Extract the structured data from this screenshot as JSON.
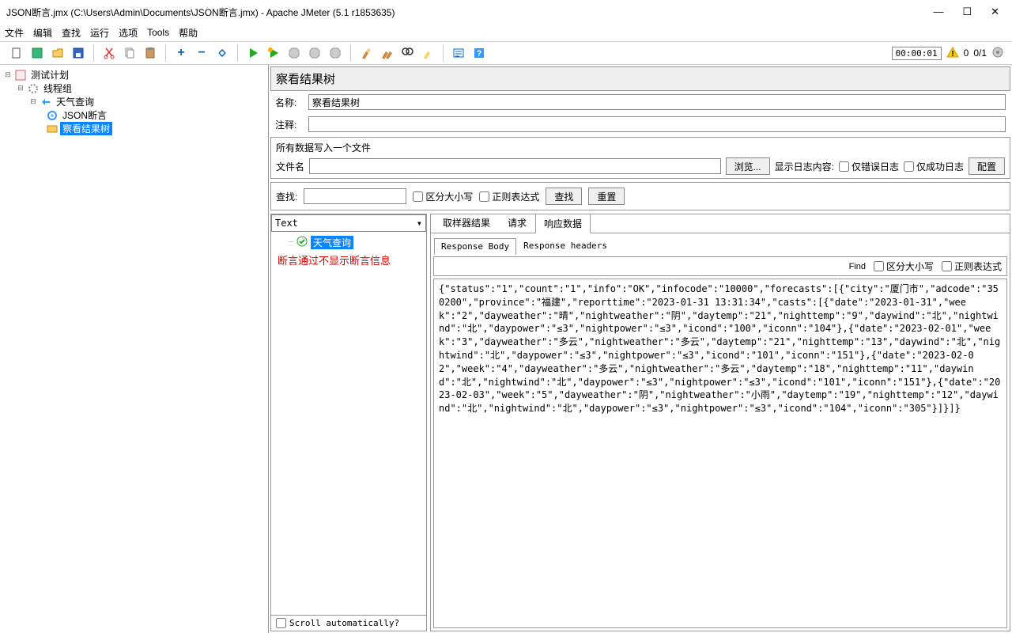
{
  "window": {
    "title": "JSON断言.jmx (C:\\Users\\Admin\\Documents\\JSON断言.jmx) - Apache JMeter (5.1 r1853635)"
  },
  "menu": {
    "file": "文件",
    "edit": "编辑",
    "search": "查找",
    "run": "运行",
    "options": "选项",
    "tools": "Tools",
    "help": "帮助"
  },
  "toolbar_right": {
    "timer": "00:00:01",
    "count": "0",
    "thread_ratio": "0/1"
  },
  "tree": {
    "root": "测试计划",
    "thread_group": "线程组",
    "sampler": "天气查询",
    "assertion": "JSON断言",
    "listener": "察看结果树"
  },
  "panel": {
    "title": "察看结果树",
    "name_label": "名称:",
    "name_value": "察看结果树",
    "comment_label": "注释:"
  },
  "file_write": {
    "title": "所有数据写入一个文件",
    "filename_label": "文件名",
    "browse": "浏览...",
    "log_content_label": "显示日志内容:",
    "error_only": "仅错误日志",
    "success_only": "仅成功日志",
    "config": "配置"
  },
  "search_bar": {
    "label": "查找:",
    "case_sensitive": "区分大小写",
    "regex": "正则表达式",
    "search_btn": "查找",
    "reset_btn": "重置"
  },
  "results": {
    "dropdown": "Text",
    "sample": "天气查询",
    "red_note": "断言通过不显示断言信息",
    "scroll_auto": "Scroll automatically?"
  },
  "tabs": {
    "sampler": "取样器结果",
    "request": "请求",
    "response": "响应数据"
  },
  "subtabs": {
    "body": "Response Body",
    "headers": "Response headers"
  },
  "find": {
    "label": "Find",
    "case": "区分大小写",
    "regex": "正则表达式"
  },
  "response_body": "{\"status\":\"1\",\"count\":\"1\",\"info\":\"OK\",\"infocode\":\"10000\",\"forecasts\":[{\"city\":\"厦门市\",\"adcode\":\"350200\",\"province\":\"福建\",\"reporttime\":\"2023-01-31 13:31:34\",\"casts\":[{\"date\":\"2023-01-31\",\"week\":\"2\",\"dayweather\":\"晴\",\"nightweather\":\"阴\",\"daytemp\":\"21\",\"nighttemp\":\"9\",\"daywind\":\"北\",\"nightwind\":\"北\",\"daypower\":\"≤3\",\"nightpower\":\"≤3\",\"icond\":\"100\",\"iconn\":\"104\"},{\"date\":\"2023-02-01\",\"week\":\"3\",\"dayweather\":\"多云\",\"nightweather\":\"多云\",\"daytemp\":\"21\",\"nighttemp\":\"13\",\"daywind\":\"北\",\"nightwind\":\"北\",\"daypower\":\"≤3\",\"nightpower\":\"≤3\",\"icond\":\"101\",\"iconn\":\"151\"},{\"date\":\"2023-02-02\",\"week\":\"4\",\"dayweather\":\"多云\",\"nightweather\":\"多云\",\"daytemp\":\"18\",\"nighttemp\":\"11\",\"daywind\":\"北\",\"nightwind\":\"北\",\"daypower\":\"≤3\",\"nightpower\":\"≤3\",\"icond\":\"101\",\"iconn\":\"151\"},{\"date\":\"2023-02-03\",\"week\":\"5\",\"dayweather\":\"阴\",\"nightweather\":\"小雨\",\"daytemp\":\"19\",\"nighttemp\":\"12\",\"daywind\":\"北\",\"nightwind\":\"北\",\"daypower\":\"≤3\",\"nightpower\":\"≤3\",\"icond\":\"104\",\"iconn\":\"305\"}]}]}"
}
